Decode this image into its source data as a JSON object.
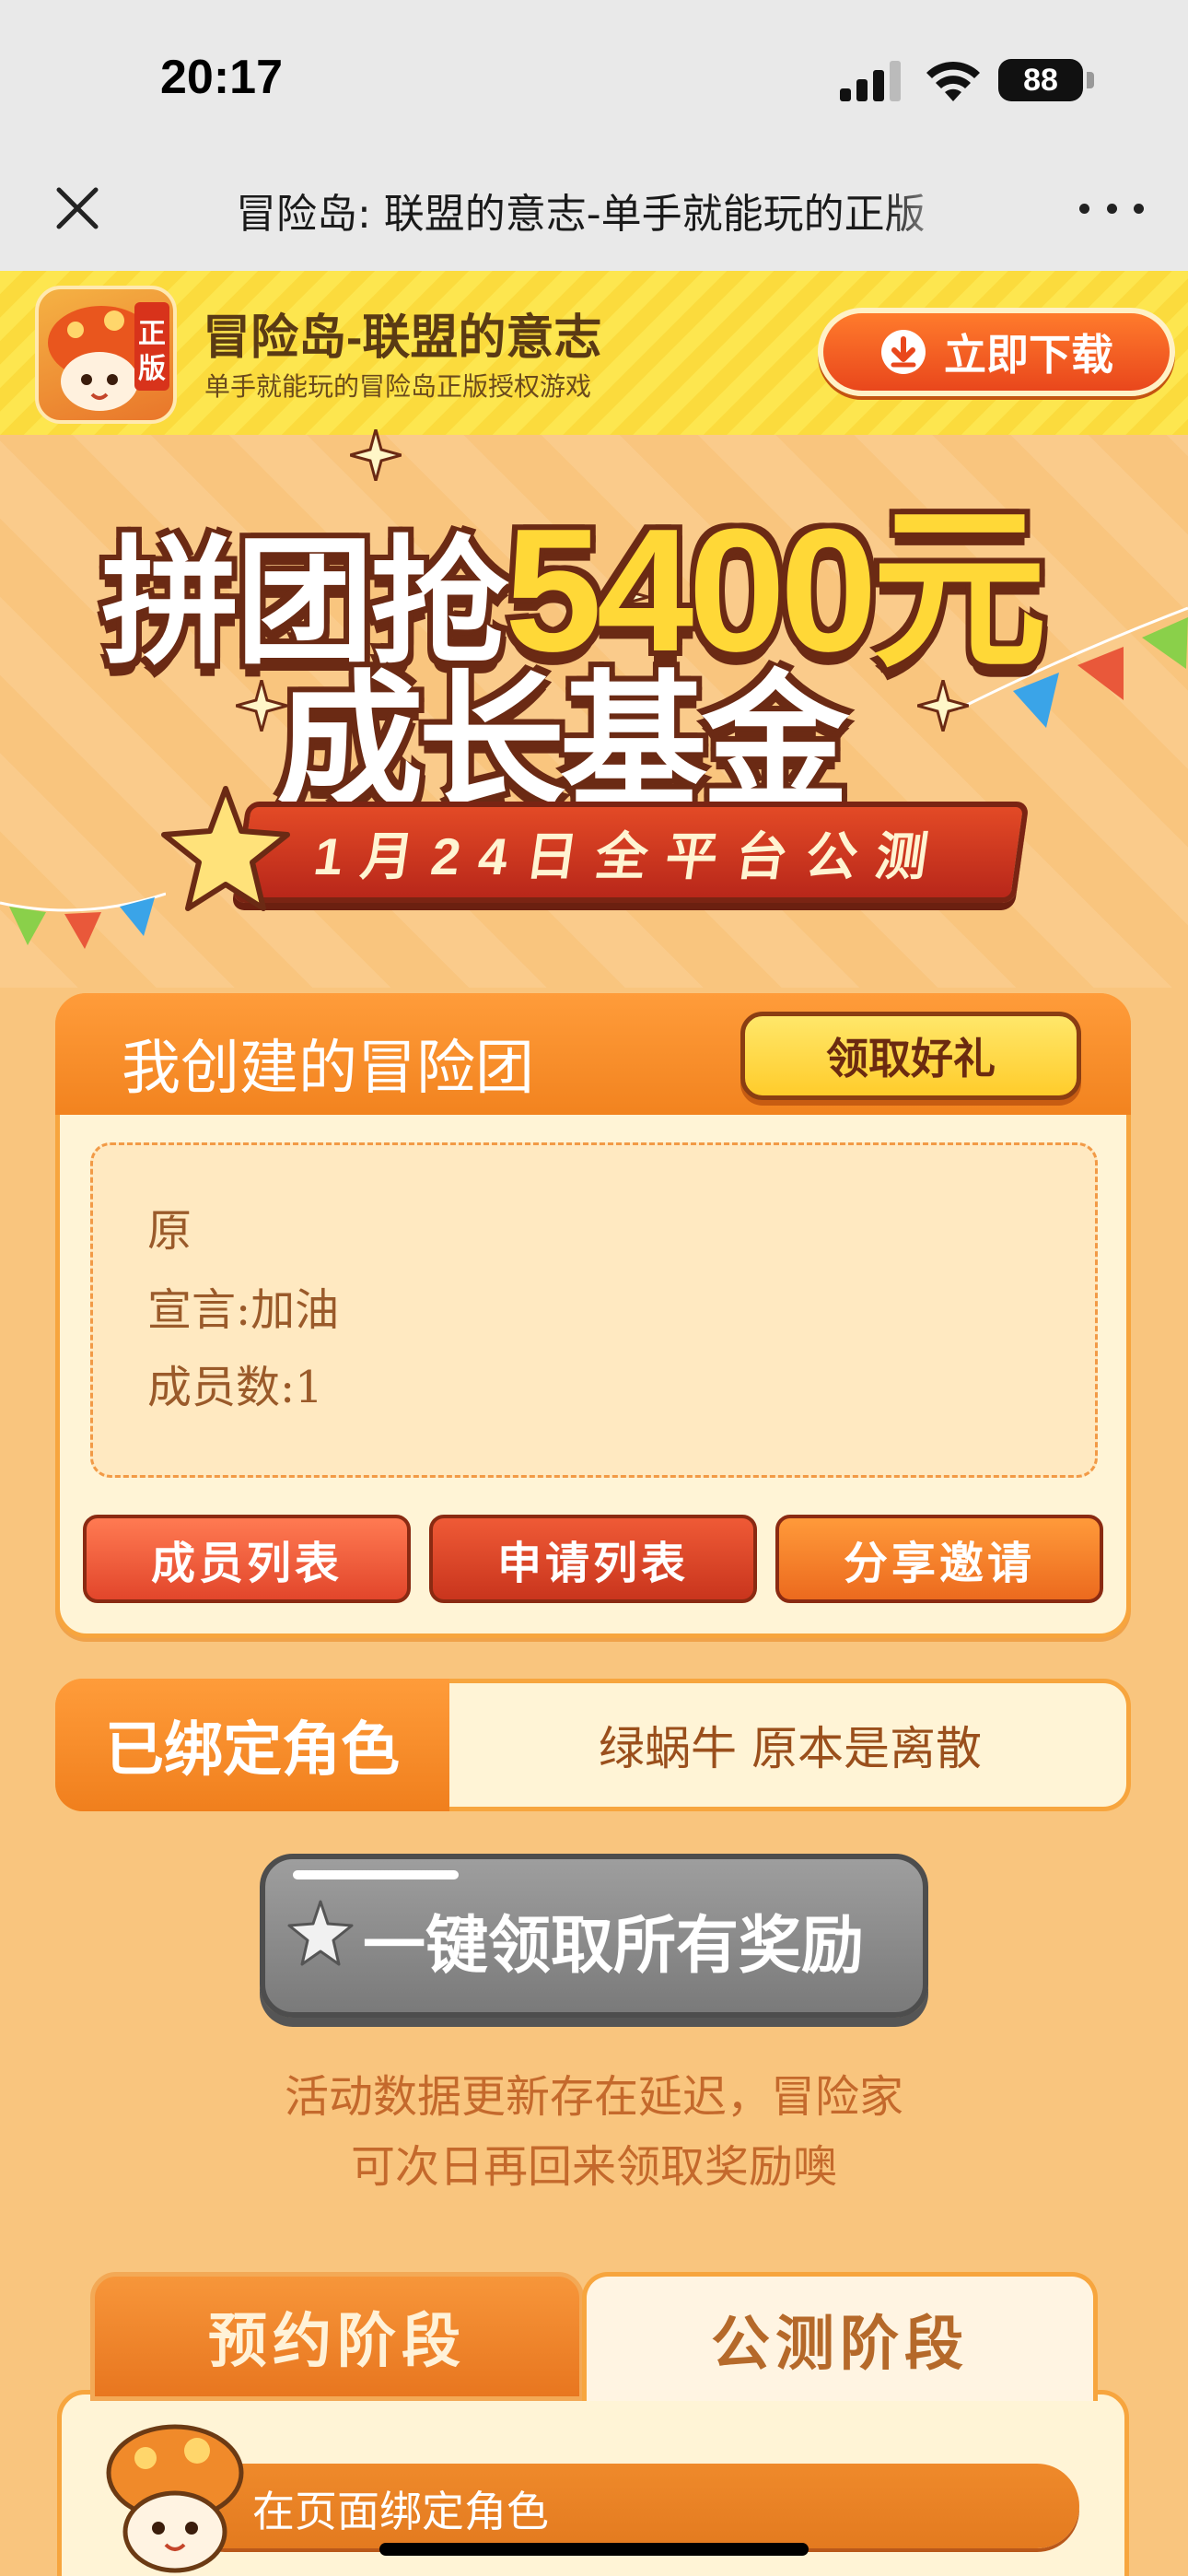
{
  "status_bar": {
    "time": "20:17",
    "battery": "88"
  },
  "nav": {
    "title": "冒险岛: 联盟的意志-单手就能玩的正版"
  },
  "download_banner": {
    "app_name": "冒险岛-联盟的意志",
    "app_subtitle": "单手就能玩的冒险岛正版授权游戏",
    "icon_badge": "正版",
    "button_label": "立即下载"
  },
  "hero": {
    "line1_prefix": "拼团抢",
    "line1_amount": "5400元",
    "line2": "成长基金",
    "date_ribbon": "1月24日全平台公测"
  },
  "team_card": {
    "title": "我创建的冒险团",
    "gift_button": "领取好礼",
    "name": "原",
    "motto": "宣言:加油",
    "members": "成员数:1",
    "buttons": {
      "members": "成员列表",
      "applications": "申请列表",
      "share": "分享邀请"
    }
  },
  "bound_role": {
    "label": "已绑定角色",
    "value": "绿蜗牛 原本是离散"
  },
  "claim_all": {
    "label": "一键领取所有奖励"
  },
  "notice": {
    "line1": "活动数据更新存在延迟，冒险家",
    "line2": "可次日再回来领取奖励噢"
  },
  "stages": {
    "tabs": [
      {
        "label": "预约阶段"
      },
      {
        "label": "公测阶段"
      }
    ],
    "step1": "在页面绑定角色"
  }
}
